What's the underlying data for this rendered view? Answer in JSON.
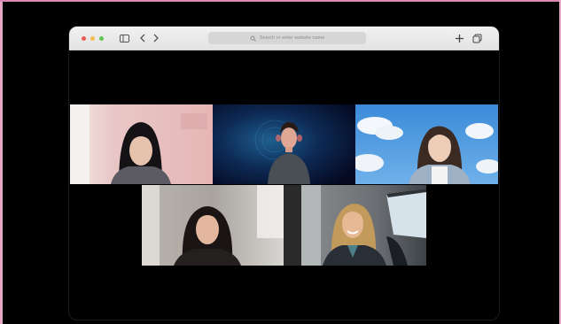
{
  "browser": {
    "url_placeholder": "Search or enter website name",
    "traffic_lights": {
      "close": "#ee5a52",
      "minimize": "#f4bf4f",
      "zoom": "#5fc455"
    },
    "icons": [
      "sidebar-icon",
      "back-icon",
      "forward-icon",
      "search-icon",
      "new-tab-icon",
      "tab-overview-icon"
    ]
  },
  "video_call": {
    "participants": [
      {
        "tile": "participant-1",
        "background": "pink room"
      },
      {
        "tile": "participant-2",
        "background": "dark blue digital"
      },
      {
        "tile": "participant-3",
        "background": "blue sky with clouds"
      },
      {
        "tile": "participant-4",
        "background": "grey room"
      },
      {
        "tile": "participant-5",
        "background": "car interior"
      }
    ]
  },
  "colors": {
    "frame_accent": "#e7a6c5",
    "toolbar": "#e8e8e8",
    "page_bg": "#000000"
  }
}
